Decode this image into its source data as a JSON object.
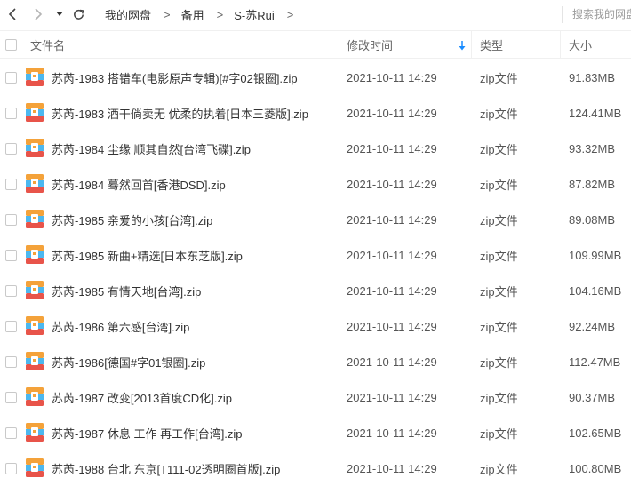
{
  "nav": {
    "breadcrumbs": [
      "我的网盘",
      "备用",
      "S-苏Rui"
    ],
    "separator": ">",
    "search_placeholder": "搜索我的网盘文件"
  },
  "header": {
    "name": "文件名",
    "modified": "修改时间",
    "type": "类型",
    "size": "大小",
    "sort_color": "#1a8cff"
  },
  "files": [
    {
      "name": "苏芮-1983 搭错车(电影原声专辑)[#字02银圈].zip",
      "modified": "2021-10-11 14:29",
      "type": "zip文件",
      "size": "91.83MB"
    },
    {
      "name": "苏芮-1983 酒干倘卖无 优柔的执着[日本三菱版].zip",
      "modified": "2021-10-11 14:29",
      "type": "zip文件",
      "size": "124.41MB"
    },
    {
      "name": "苏芮-1984 尘缘 顺其自然[台湾飞碟].zip",
      "modified": "2021-10-11 14:29",
      "type": "zip文件",
      "size": "93.32MB"
    },
    {
      "name": "苏芮-1984 蓦然回首[香港DSD].zip",
      "modified": "2021-10-11 14:29",
      "type": "zip文件",
      "size": "87.82MB"
    },
    {
      "name": "苏芮-1985 亲爱的小孩[台湾].zip",
      "modified": "2021-10-11 14:29",
      "type": "zip文件",
      "size": "89.08MB"
    },
    {
      "name": "苏芮-1985 新曲+精选[日本东芝版].zip",
      "modified": "2021-10-11 14:29",
      "type": "zip文件",
      "size": "109.99MB"
    },
    {
      "name": "苏芮-1985 有情天地[台湾].zip",
      "modified": "2021-10-11 14:29",
      "type": "zip文件",
      "size": "104.16MB"
    },
    {
      "name": "苏芮-1986 第六感[台湾].zip",
      "modified": "2021-10-11 14:29",
      "type": "zip文件",
      "size": "92.24MB"
    },
    {
      "name": "苏芮-1986[德国#字01银圈].zip",
      "modified": "2021-10-11 14:29",
      "type": "zip文件",
      "size": "112.47MB"
    },
    {
      "name": "苏芮-1987 改变[2013首度CD化].zip",
      "modified": "2021-10-11 14:29",
      "type": "zip文件",
      "size": "90.37MB"
    },
    {
      "name": "苏芮-1987 休息 工作 再工作[台湾].zip",
      "modified": "2021-10-11 14:29",
      "type": "zip文件",
      "size": "102.65MB"
    },
    {
      "name": "苏芮-1988 台北 东京[T111-02透明圈首版].zip",
      "modified": "2021-10-11 14:29",
      "type": "zip文件",
      "size": "100.80MB"
    }
  ]
}
